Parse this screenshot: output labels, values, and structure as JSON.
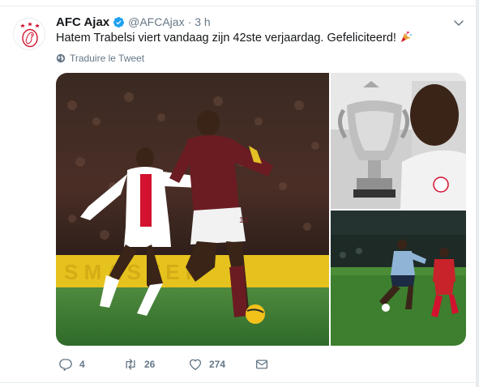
{
  "tweet": {
    "author_name": "AFC Ajax",
    "handle": "@AFCAjax",
    "separator": "·",
    "time": "3 h",
    "text": "Hatem Trabelsi viert vandaag zijn 42ste verjaardag. Gefeliciteerd!",
    "translate_label": "Traduire le Tweet"
  },
  "actions": {
    "replies": "4",
    "retweets": "26",
    "likes": "274"
  },
  "colors": {
    "accent": "#1da1f2",
    "secondary_text": "#657786",
    "divider": "#e6ecf0",
    "ajax_red": "#d2122e"
  },
  "icons": {
    "verified": "verified-badge-icon",
    "chevron": "chevron-down-icon",
    "party": "party-popper-emoji",
    "globe": "globe-icon",
    "reply": "reply-icon",
    "retweet": "retweet-icon",
    "like": "heart-icon",
    "dm": "envelope-icon"
  },
  "media": {
    "photos": [
      "match-photo-arsenal-ajax",
      "trophy-photo",
      "match-photo-night"
    ]
  }
}
